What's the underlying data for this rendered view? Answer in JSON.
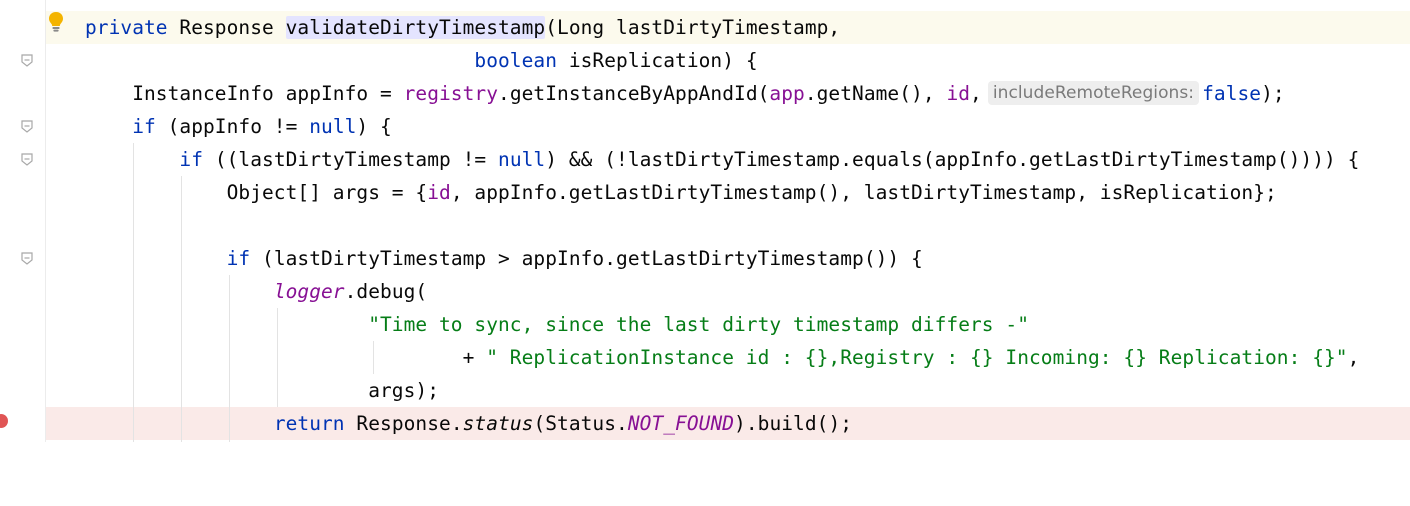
{
  "editor": {
    "icons": {
      "intention": "lightbulb-icon",
      "fold": "fold-marker-icon",
      "breakpoint": "breakpoint-icon"
    },
    "colors": {
      "keyword": "#0033b3",
      "field": "#871094",
      "string": "#067d17",
      "current_line": "#fcfaed",
      "breakpoint_line": "#faeae8",
      "breakpoint": "#e05555"
    },
    "lines": [
      {
        "t1": "private",
        "t2": " Response ",
        "t3": "validateDirtyTimestamp",
        "t4": "(Long lastDirtyTimestamp,"
      },
      {
        "t1": "                                 ",
        "t2": "boolean",
        "t3": " isReplication) {"
      },
      {
        "t1": "    InstanceInfo appInfo = ",
        "t2": "registry",
        "t3": ".getInstanceByAppAndId(",
        "t4": "app",
        "t5": ".getName(), ",
        "t6": "id",
        "t7": ",",
        "hint": "includeRemoteRegions:",
        "t8": "false",
        "t9": ");"
      },
      {
        "t1": "    ",
        "t2": "if",
        "t3": " (appInfo != ",
        "t4": "null",
        "t5": ") {"
      },
      {
        "t1": "        ",
        "t2": "if",
        "t3": " ((lastDirtyTimestamp != ",
        "t4": "null",
        "t5": ") && (!lastDirtyTimestamp.equals(appInfo.getLastDirtyTimestamp()))) {"
      },
      {
        "t1": "            Object[] args = {",
        "t2": "id",
        "t3": ", appInfo.getLastDirtyTimestamp(), lastDirtyTimestamp, isReplication};"
      },
      {
        "t1": ""
      },
      {
        "t1": "            ",
        "t2": "if",
        "t3": " (lastDirtyTimestamp > appInfo.getLastDirtyTimestamp()) {"
      },
      {
        "t1": "                ",
        "t2": "logger",
        "t3": ".debug("
      },
      {
        "t1": "                        ",
        "t2": "\"Time to sync, since the last dirty timestamp differs -\""
      },
      {
        "t1": "                                + ",
        "t2": "\" ReplicationInstance id : {},Registry : {} Incoming: {} Replication: {}\"",
        "t3": ","
      },
      {
        "t1": "                        args);"
      },
      {
        "t1": "                ",
        "t2": "return",
        "t3": " Response.",
        "t4": "status",
        "t5": "(Status.",
        "t6": "NOT_FOUND",
        "t7": ").build();"
      }
    ]
  }
}
